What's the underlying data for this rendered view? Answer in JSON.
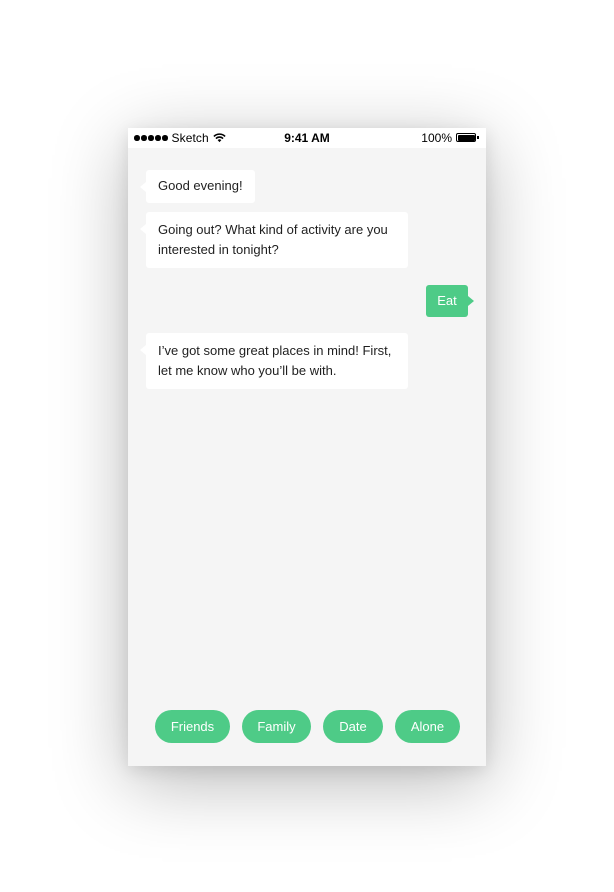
{
  "status_bar": {
    "carrier": "Sketch",
    "time": "9:41 AM",
    "battery": "100%"
  },
  "messages": [
    {
      "from": "bot",
      "text": "Good evening!"
    },
    {
      "from": "bot",
      "text": "Going out? What kind of activity are you interested in tonight?"
    },
    {
      "from": "user",
      "text": "Eat"
    },
    {
      "from": "bot",
      "text": "I’ve got some great places in mind! First, let me know who you’ll be with."
    }
  ],
  "quick_replies": [
    "Friends",
    "Family",
    "Date",
    "Alone"
  ],
  "colors": {
    "accent": "#4ecb87",
    "background": "#f5f5f5",
    "bubble": "#ffffff",
    "text": "#1f1f1f"
  },
  "icons": [
    "signal-icon",
    "wifi-icon",
    "battery-icon"
  ]
}
